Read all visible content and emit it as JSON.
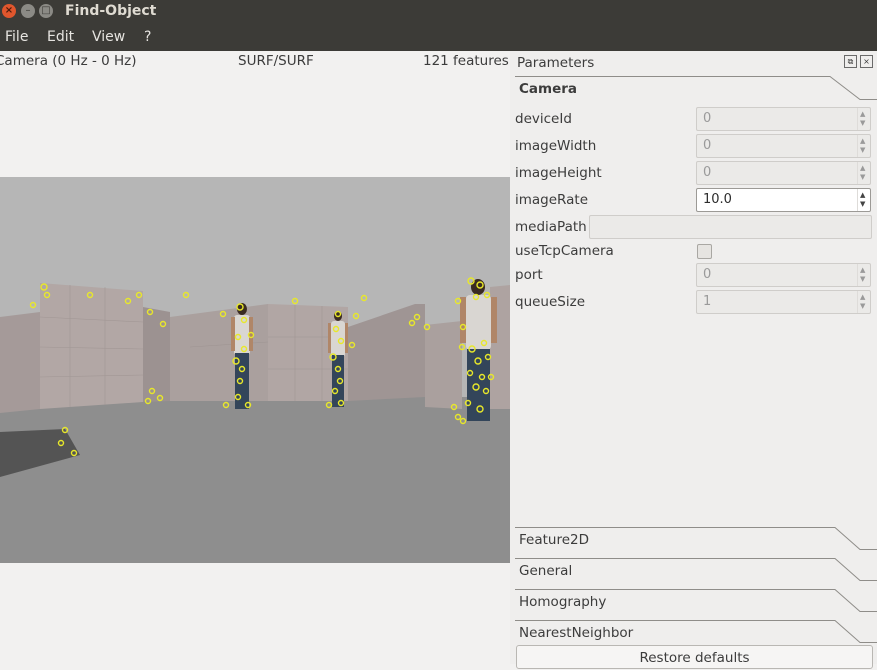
{
  "window": {
    "title": "Find-Object",
    "close_glyph": "×",
    "min_glyph": "–",
    "max_glyph": "□"
  },
  "menu": [
    "File",
    "Edit",
    "View",
    "?"
  ],
  "status": {
    "camera": "Camera (0 Hz - 0 Hz)",
    "detector": "SURF/SURF",
    "features": "121 features"
  },
  "dock": {
    "title": "Parameters",
    "float_glyph": "⧉",
    "close_glyph": "×"
  },
  "sections": {
    "camera": "Camera",
    "feature2d": "Feature2D",
    "general": "General",
    "homography": "Homography",
    "nearest": "NearestNeighbor"
  },
  "params": {
    "deviceId": {
      "label": "deviceId",
      "value": "0"
    },
    "imageWidth": {
      "label": "imageWidth",
      "value": "0"
    },
    "imageHeight": {
      "label": "imageHeight",
      "value": "0"
    },
    "imageRate": {
      "label": "imageRate",
      "value": "10.0"
    },
    "mediaPath": {
      "label": "mediaPath",
      "value": ""
    },
    "useTcpCamera": {
      "label": "useTcpCamera",
      "checked": false
    },
    "port": {
      "label": "port",
      "value": "0"
    },
    "queueSize": {
      "label": "queueSize",
      "value": "1"
    }
  },
  "restore_label": "Restore defaults",
  "colors": {
    "titlebar": "#3c3b37",
    "keypoint": "#e8e82a",
    "floor": "#8c8c8c",
    "sky": "#b5b5b5"
  }
}
